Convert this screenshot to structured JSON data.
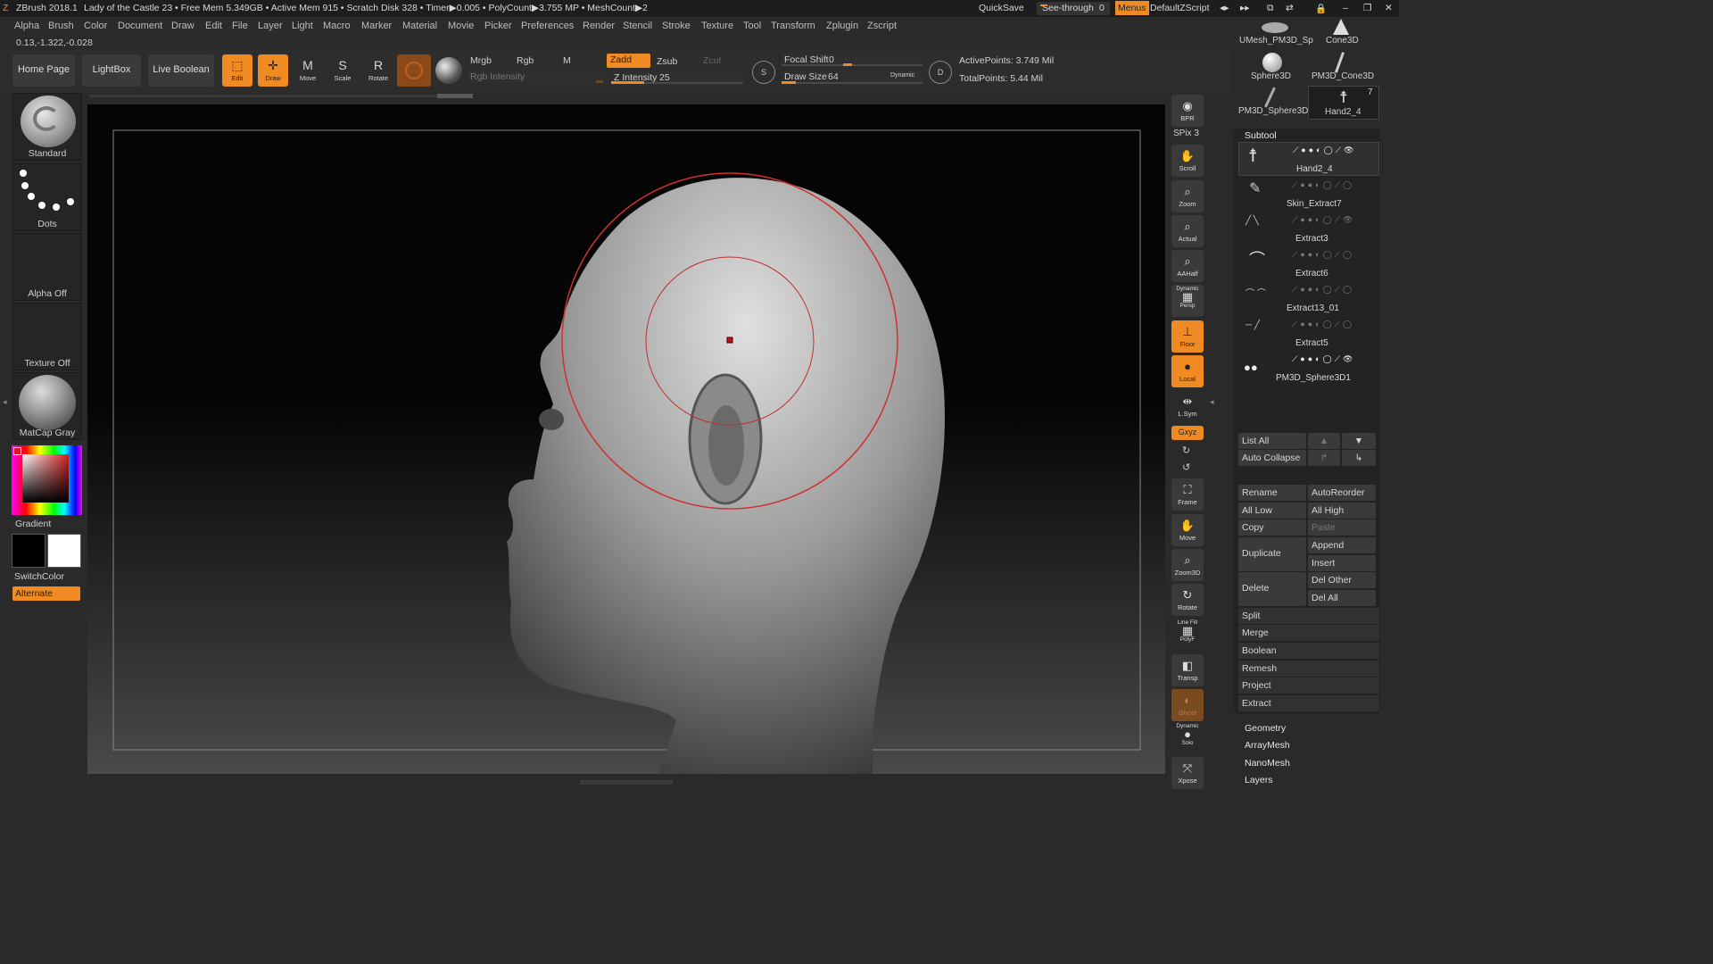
{
  "title_bar": {
    "app": "ZBrush 2018.1",
    "document": "Lady of the Castle 23",
    "stats": "• Free Mem 5.349GB • Active Mem 915 • Scratch Disk 328 • Timer▶0.005 • PolyCount▶3.755 MP • MeshCount▶2",
    "quicksave": "QuickSave",
    "see_through": "See-through",
    "see_through_value": "0",
    "menus": "Menus",
    "script": "DefaultZScript"
  },
  "menu": [
    "Alpha",
    "Brush",
    "Color",
    "Document",
    "Draw",
    "Edit",
    "File",
    "Layer",
    "Light",
    "Macro",
    "Marker",
    "Material",
    "Movie",
    "Picker",
    "Preferences",
    "Render",
    "Stencil",
    "Stroke",
    "Texture",
    "Tool",
    "Transform",
    "Zplugin",
    "Zscript"
  ],
  "coords": "0.13,-1.322,-0.028",
  "toolbar": {
    "home": "Home Page",
    "lightbox": "LightBox",
    "live_boolean": "Live Boolean",
    "edit": "Edit",
    "draw": "Draw",
    "move": "Move",
    "scale": "Scale",
    "rotate": "Rotate",
    "mrgb": "Mrgb",
    "rgb": "Rgb",
    "m": "M",
    "rgb_intensity": "Rgb Intensity",
    "zadd": "Zadd",
    "zsub": "Zsub",
    "zcut": "Zcut",
    "z_intensity_label": "Z Intensity",
    "z_intensity": "25",
    "focal_shift_label": "Focal Shift",
    "focal_shift": "0",
    "draw_size_label": "Draw Size",
    "draw_size": "64",
    "dynamic": "Dynamic",
    "active_points": "ActivePoints: 3.749 Mil",
    "total_points": "TotalPoints: 5.44 Mil",
    "z_intensity_fraction": 0.25,
    "focal_shift_fraction": 0.5,
    "draw_size_fraction": 0.1
  },
  "left_shelf": {
    "brush": "Standard",
    "stroke": "Dots",
    "alpha": "Alpha Off",
    "texture": "Texture Off",
    "material": "MatCap Gray",
    "gradient": "Gradient",
    "switch_color": "SwitchColor",
    "alternate": "Alternate"
  },
  "right_shelf": {
    "bpr": "BPR",
    "spix": "SPix 3",
    "scroll": "Scroll",
    "zoom": "Zoom",
    "actual": "Actual",
    "aahalf": "AAHalf",
    "dynamic": "Dynamic",
    "persp": "Persp",
    "floor": "Floor",
    "local": "Local",
    "lsym": "L.Sym",
    "xyz": "Gxyz",
    "frame": "Frame",
    "move": "Move",
    "zoom3d": "Zoom3D",
    "rotate": "Rotate",
    "line_fill": "Line Fill",
    "polyf": "PolyF",
    "transp": "Transp",
    "ghost": "Ghost",
    "solo_dynamic": "Dynamic",
    "solo": "Solo",
    "xpose": "Xpose"
  },
  "tool_thumbs": [
    {
      "name": "UMesh_PM3D_Sp"
    },
    {
      "name": "Cone3D"
    },
    {
      "name": "Sphere3D"
    },
    {
      "name": "PM3D_Cone3D"
    },
    {
      "name": "PM3D_Sphere3D"
    },
    {
      "name": "Hand2_4",
      "badge": "7"
    }
  ],
  "subtool": {
    "header": "Subtool",
    "items": [
      "Hand2_4",
      "Skin_Extract7",
      "Extract3",
      "Extract6",
      "Extract13_01",
      "Extract5",
      "PM3D_Sphere3D1"
    ],
    "list_all": "List All",
    "auto_collapse": "Auto Collapse",
    "rename": "Rename",
    "auto_reorder": "AutoReorder",
    "all_low": "All Low",
    "all_high": "All High",
    "copy": "Copy",
    "paste": "Paste",
    "duplicate": "Duplicate",
    "append": "Append",
    "insert": "Insert",
    "delete": "Delete",
    "del_other": "Del Other",
    "del_all": "Del All",
    "split": "Split",
    "merge": "Merge",
    "boolean": "Boolean",
    "remesh": "Remesh",
    "project": "Project",
    "extract": "Extract"
  },
  "sections": [
    "Geometry",
    "ArrayMesh",
    "NanoMesh",
    "Layers"
  ],
  "colors": {
    "accent": "#f08a23",
    "bg": "#2a2a2a",
    "canvas": "#0a0a0a",
    "brush_ring": "#d03030"
  }
}
